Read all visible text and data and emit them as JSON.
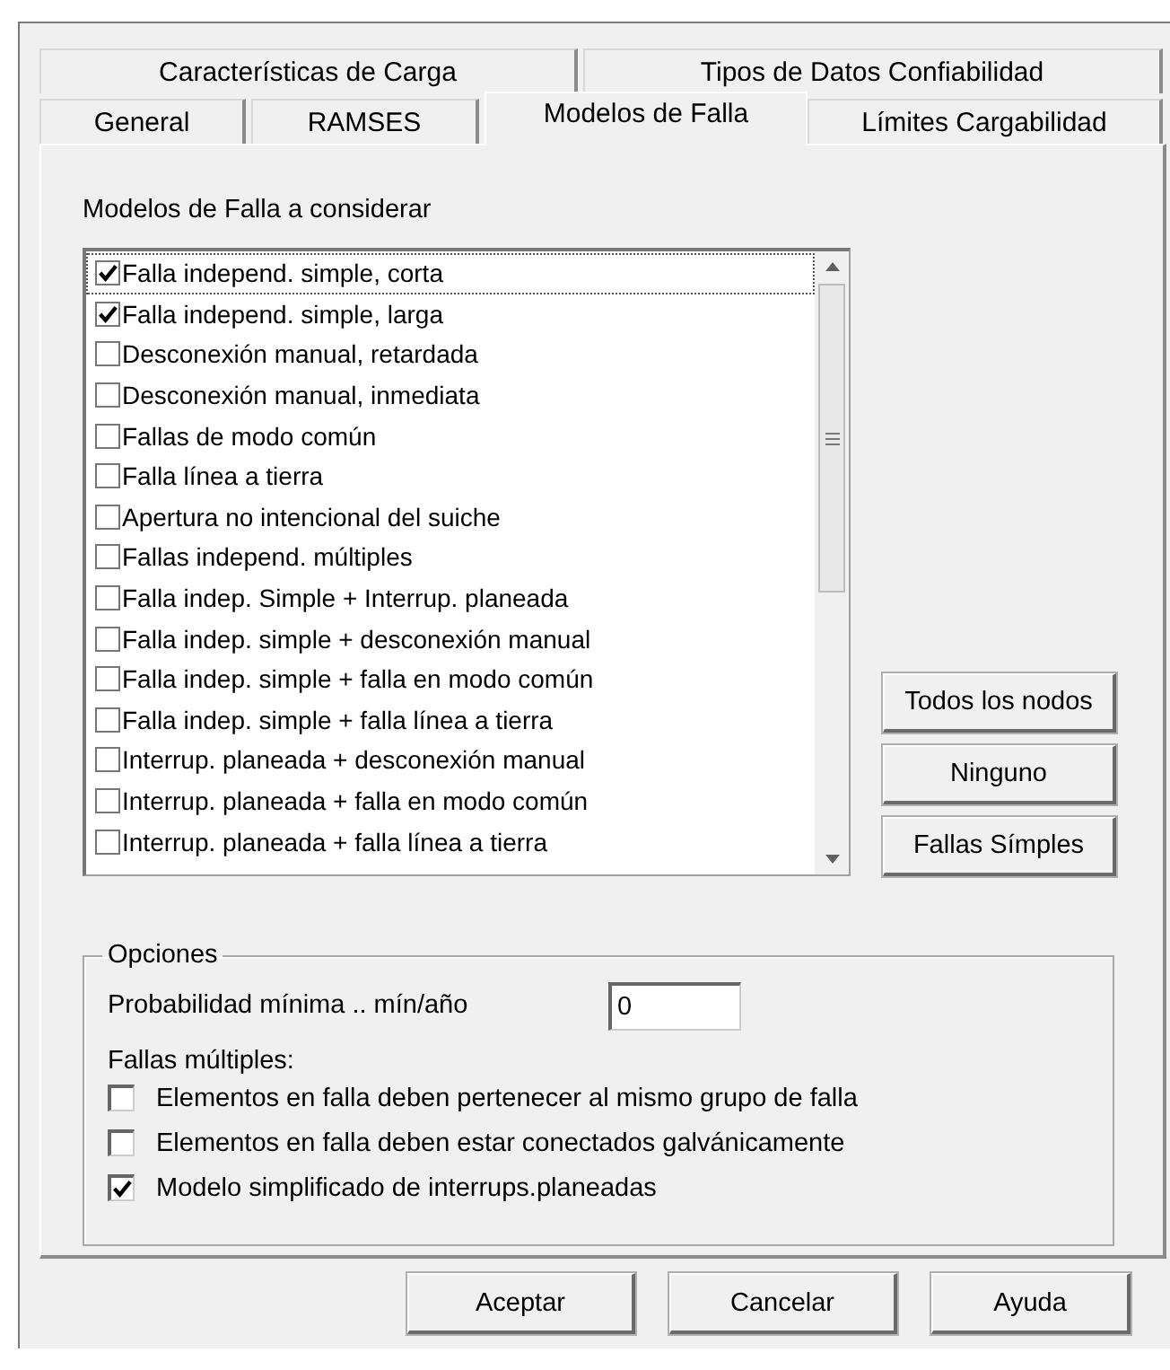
{
  "tab_rows": [
    [
      {
        "label": "Características de Carga",
        "selected": false
      },
      {
        "label": "Tipos de Datos Confiabilidad",
        "selected": false
      }
    ],
    [
      {
        "label": "General",
        "selected": false
      },
      {
        "label": "RAMSES",
        "selected": false
      },
      {
        "label": "Modelos de Falla",
        "selected": true
      },
      {
        "label": "Límites Cargabilidad",
        "selected": false
      }
    ]
  ],
  "fault_models": {
    "title": "Modelos de Falla a considerar",
    "items": [
      {
        "label": "Falla independ. simple, corta",
        "checked": true,
        "focused": true
      },
      {
        "label": "Falla  independ. simple, larga",
        "checked": true,
        "focused": false
      },
      {
        "label": "Desconexión manual, retardada",
        "checked": false,
        "focused": false
      },
      {
        "label": "Desconexión manual, inmediata",
        "checked": false,
        "focused": false
      },
      {
        "label": "Fallas de modo común",
        "checked": false,
        "focused": false
      },
      {
        "label": "Falla línea a tierra",
        "checked": false,
        "focused": false
      },
      {
        "label": "Apertura no intencional del suiche",
        "checked": false,
        "focused": false
      },
      {
        "label": "Fallas  independ. múltiples",
        "checked": false,
        "focused": false
      },
      {
        "label": "Falla indep. Simple + Interrup. planeada",
        "checked": false,
        "focused": false
      },
      {
        "label": "Falla indep. simple + desconexión manual",
        "checked": false,
        "focused": false
      },
      {
        "label": "Falla indep. simple + falla en modo común",
        "checked": false,
        "focused": false
      },
      {
        "label": "Falla indep. simple + falla línea a tierra",
        "checked": false,
        "focused": false
      },
      {
        "label": "Interrup. planeada + desconexión manual",
        "checked": false,
        "focused": false
      },
      {
        "label": "Interrup. planeada + falla en modo común",
        "checked": false,
        "focused": false
      },
      {
        "label": "Interrup. planeada + falla línea a tierra",
        "checked": false,
        "focused": false
      }
    ]
  },
  "side_buttons": [
    "Todos los nodos",
    "Ninguno",
    "Fallas Símples"
  ],
  "options": {
    "title": "Opciones",
    "probability_label": "Probabilidad mínima .. mín/año",
    "probability_value": "0",
    "multiple_label": "Fallas múltiples:",
    "checkboxes": [
      {
        "label": "Elementos en falla deben pertenecer al mismo grupo de falla",
        "checked": false
      },
      {
        "label": "Elementos en falla deben estar conectados galvánicamente",
        "checked": false
      },
      {
        "label": "Modelo simplificado de interrups.planeadas",
        "checked": true
      }
    ]
  },
  "buttons": [
    "Aceptar",
    "Cancelar",
    "Ayuda"
  ]
}
